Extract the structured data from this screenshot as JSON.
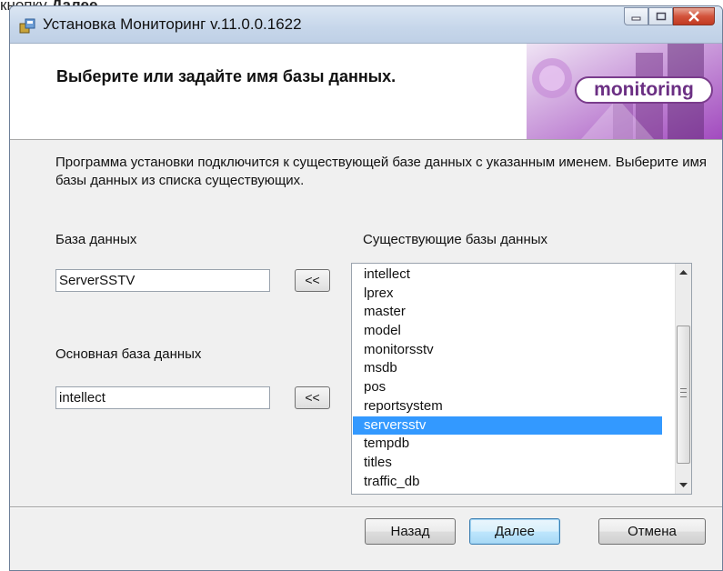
{
  "caption": {
    "prefix": "кнопку ",
    "bold": "Далее"
  },
  "window": {
    "title": "Установка Мониторинг v.11.0.0.1622"
  },
  "banner": {
    "title": "Выберите или задайте имя базы данных.",
    "logo_text": "monitoring"
  },
  "description": "Программа установки подключится к существующей базе данных с указанным именем. Выберите имя базы данных из списка существующих.",
  "database": {
    "label": "База данных",
    "value": "ServerSSTV",
    "copy_button": "<<"
  },
  "main_database": {
    "label": "Основная база данных",
    "value": "intellect",
    "copy_button": "<<"
  },
  "existing": {
    "label": "Существующие базы данных",
    "items": [
      "intellect",
      "lprex",
      "master",
      "model",
      "monitorsstv",
      "msdb",
      "pos",
      "reportsystem",
      "serversstv",
      "tempdb",
      "titles",
      "traffic_db"
    ],
    "selected_index": 8
  },
  "footer": {
    "back": "Назад",
    "next": "Далее",
    "cancel": "Отмена"
  },
  "colors": {
    "selection": "#3399ff",
    "logo": "#6b2f83",
    "close_button": "#d3533b"
  }
}
